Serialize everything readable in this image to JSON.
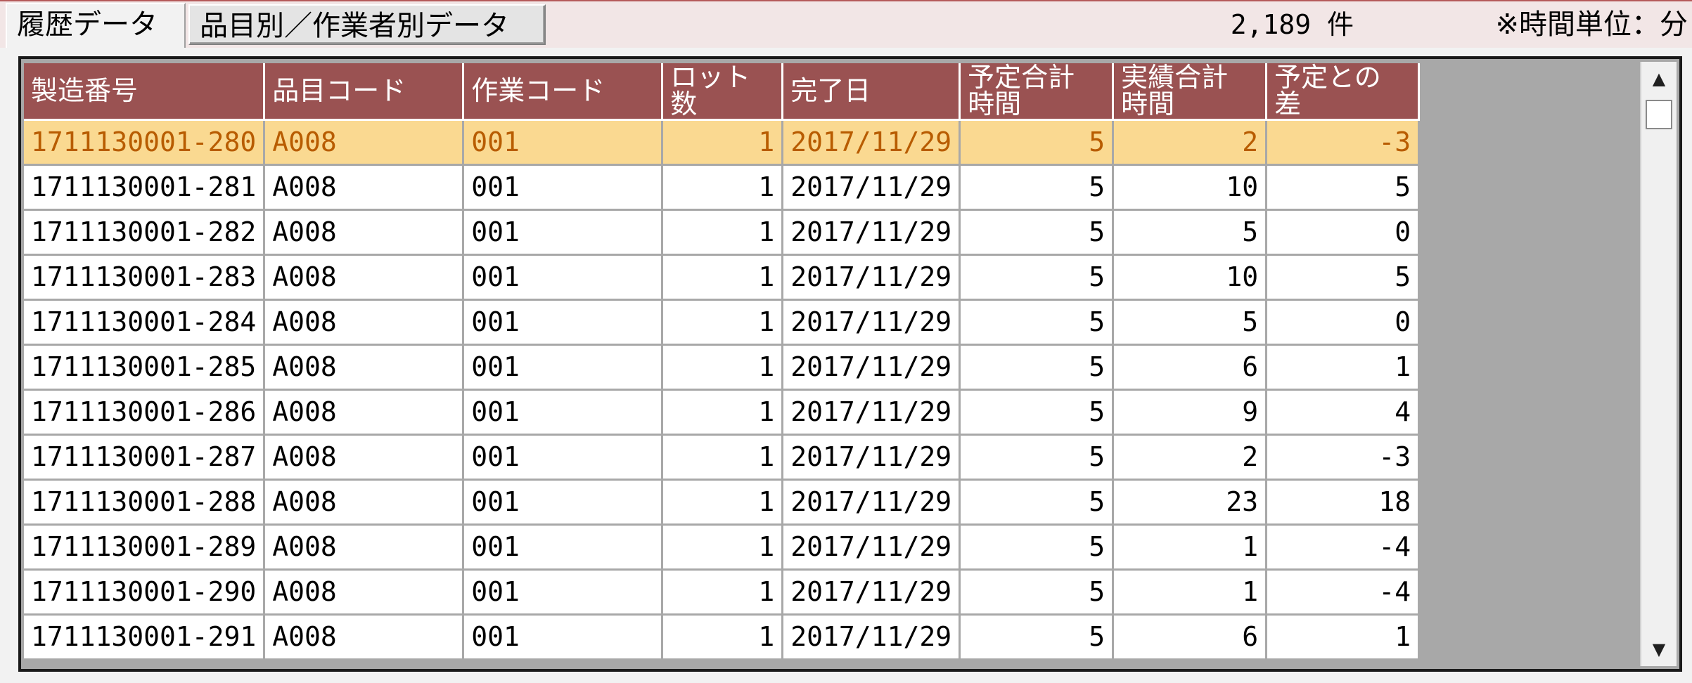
{
  "tabs": [
    {
      "label": "履歴データ",
      "active": true
    },
    {
      "label": "品目別／作業者別データ",
      "active": false
    }
  ],
  "record_count": "2,189 件",
  "time_unit_note": "※時間単位：分",
  "table": {
    "columns": [
      {
        "l1": "製造番号",
        "l2": ""
      },
      {
        "l1": "品目コード",
        "l2": ""
      },
      {
        "l1": "作業コード",
        "l2": ""
      },
      {
        "l1": "ロット",
        "l2": "数"
      },
      {
        "l1": "完了日",
        "l2": ""
      },
      {
        "l1": "予定合計",
        "l2": "時間"
      },
      {
        "l1": "実績合計",
        "l2": "時間"
      },
      {
        "l1": "予定との",
        "l2": "差"
      }
    ],
    "rows": [
      [
        "1711130001-280",
        "A008",
        "001",
        "1",
        "2017/11/29",
        "5",
        "2",
        "-3"
      ],
      [
        "1711130001-281",
        "A008",
        "001",
        "1",
        "2017/11/29",
        "5",
        "10",
        "5"
      ],
      [
        "1711130001-282",
        "A008",
        "001",
        "1",
        "2017/11/29",
        "5",
        "5",
        "0"
      ],
      [
        "1711130001-283",
        "A008",
        "001",
        "1",
        "2017/11/29",
        "5",
        "10",
        "5"
      ],
      [
        "1711130001-284",
        "A008",
        "001",
        "1",
        "2017/11/29",
        "5",
        "5",
        "0"
      ],
      [
        "1711130001-285",
        "A008",
        "001",
        "1",
        "2017/11/29",
        "5",
        "6",
        "1"
      ],
      [
        "1711130001-286",
        "A008",
        "001",
        "1",
        "2017/11/29",
        "5",
        "9",
        "4"
      ],
      [
        "1711130001-287",
        "A008",
        "001",
        "1",
        "2017/11/29",
        "5",
        "2",
        "-3"
      ],
      [
        "1711130001-288",
        "A008",
        "001",
        "1",
        "2017/11/29",
        "5",
        "23",
        "18"
      ],
      [
        "1711130001-289",
        "A008",
        "001",
        "1",
        "2017/11/29",
        "5",
        "1",
        "-4"
      ],
      [
        "1711130001-290",
        "A008",
        "001",
        "1",
        "2017/11/29",
        "5",
        "1",
        "-4"
      ],
      [
        "1711130001-291",
        "A008",
        "001",
        "1",
        "2017/11/29",
        "5",
        "6",
        "1"
      ]
    ],
    "selected_row": 0
  },
  "scrollbar": {
    "up_icon": "▲",
    "down_icon": "▼"
  },
  "colors": {
    "header_bg": "#9a5252",
    "selected_bg": "#fad991",
    "selected_text": "#b85c00"
  }
}
